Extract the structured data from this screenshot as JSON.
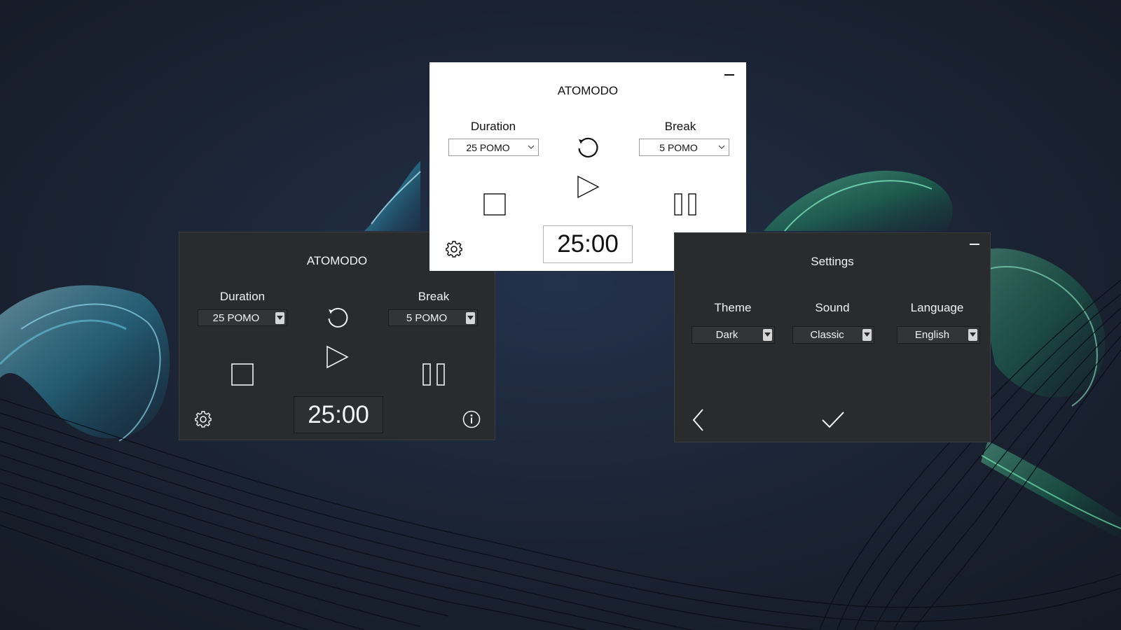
{
  "light_window": {
    "title": "ATOMODO",
    "duration_label": "Duration",
    "duration_value": "25 POMO",
    "break_label": "Break",
    "break_value": "5 POMO",
    "timer": "25:00"
  },
  "dark_window": {
    "title": "ATOMODO",
    "duration_label": "Duration",
    "duration_value": "25 POMO",
    "break_label": "Break",
    "break_value": "5 POMO",
    "timer": "25:00"
  },
  "settings_window": {
    "title": "Settings",
    "theme_label": "Theme",
    "theme_value": "Dark",
    "sound_label": "Sound",
    "sound_value": "Classic",
    "language_label": "Language",
    "language_value": "English"
  },
  "icons": {
    "minimize": "minimize-icon",
    "refresh": "refresh-icon",
    "play": "play-icon",
    "stop": "stop-icon",
    "pause": "pause-icon",
    "settings": "gear-icon",
    "info": "info-icon",
    "back": "chevron-left-icon",
    "confirm": "checkmark-icon"
  },
  "colors": {
    "light_bg": "#ffffff",
    "dark_bg": "#2a2b2d",
    "wallpaper": "#1b2230",
    "wallpaper_cyan": "#3fb8d8",
    "wallpaper_green": "#2fd48a"
  }
}
